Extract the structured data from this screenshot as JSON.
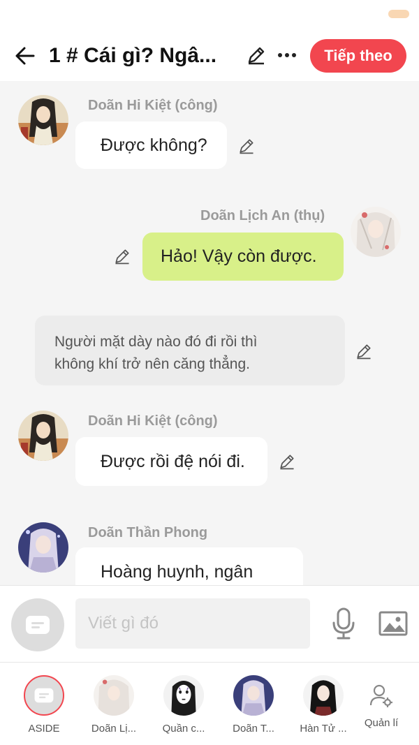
{
  "header": {
    "title": "1 # Cái gì? Ngâ...",
    "next_label": "Tiếp theo"
  },
  "messages": [
    {
      "speaker": "Doãn Hi Kiệt (công)",
      "text": "Được không?",
      "side": "left"
    },
    {
      "speaker": "Doãn Lịch An (thụ)",
      "text": "Hảo! Vậy còn được.",
      "side": "right"
    },
    {
      "type": "narration",
      "line1": "Người mặt dày nào đó đi rồi thì",
      "line2": "không khí trở nên căng thẳng."
    },
    {
      "speaker": "Doãn Hi Kiệt (công)",
      "text": "Được rồi đệ nói đi.",
      "side": "left"
    },
    {
      "speaker": "Doãn Thần Phong",
      "text": "Hoàng huynh, ngân",
      "side": "left"
    }
  ],
  "composer": {
    "placeholder": "Viết gì đó"
  },
  "characters": [
    {
      "label": "ASIDE",
      "icon": "aside-icon"
    },
    {
      "label": "Doãn Lị..."
    },
    {
      "label": "Quần c..."
    },
    {
      "label": "Doãn T..."
    },
    {
      "label": "Hàn Tử ..."
    },
    {
      "label": "Quản lí",
      "icon": "user-settings-icon"
    }
  ],
  "colors": {
    "accent": "#f2464f",
    "right_bubble": "#d8f089",
    "left_bubble": "#ffffff",
    "background": "#f5f5f5"
  }
}
